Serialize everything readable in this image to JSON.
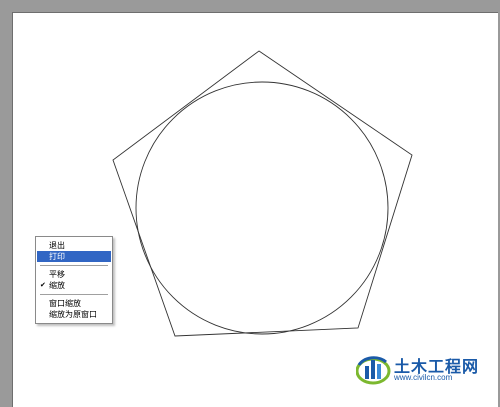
{
  "context_menu": {
    "items": [
      {
        "label": "退出",
        "checked": false,
        "highlighted": false
      },
      {
        "label": "打印",
        "checked": false,
        "highlighted": true
      },
      {
        "label": "平移",
        "checked": false,
        "highlighted": false
      },
      {
        "label": "缩放",
        "checked": true,
        "highlighted": false
      },
      {
        "label": "窗口缩放",
        "checked": false,
        "highlighted": false
      },
      {
        "label": "缩放为原窗口",
        "checked": false,
        "highlighted": false
      }
    ],
    "check_mark": "✔",
    "highlight_color": "#3166c4"
  },
  "drawing": {
    "shapes": [
      "pentagon",
      "inscribed-circle"
    ],
    "stroke_color": "#333333"
  },
  "watermark": {
    "title": "土木工程网",
    "url": "www.civilcn.com",
    "brand_color": "#1a5aa8"
  }
}
